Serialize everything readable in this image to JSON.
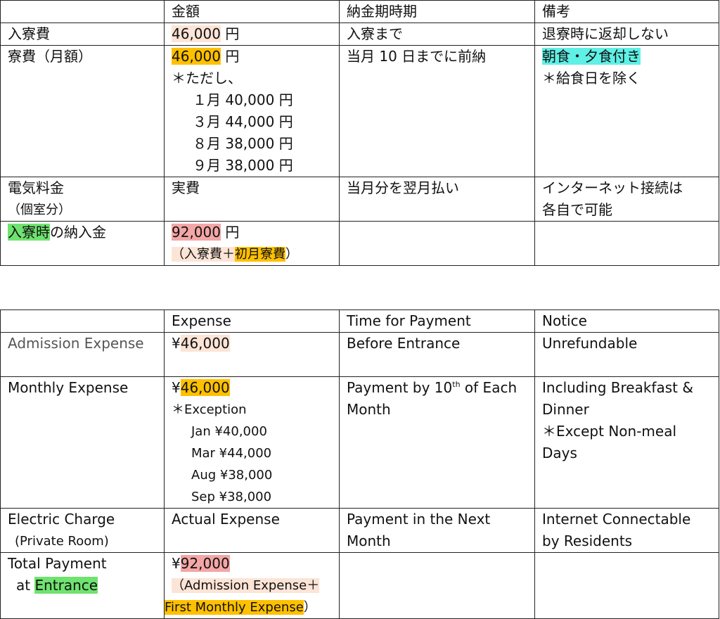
{
  "jp": {
    "headers": [
      "",
      "金額",
      "納金期時期",
      "備考"
    ],
    "row1": {
      "item": "入寮費",
      "amount_num": "46,000",
      "amount_unit": " 円",
      "timing": "入寮まで",
      "notice": "退寮時に返却しない"
    },
    "row2": {
      "item": "寮費（月額）",
      "amount_num": "46,000",
      "amount_unit": " 円",
      "exception_label": "＊ただし、",
      "exceptions": [
        "１月 40,000 円",
        "３月 44,000 円",
        "８月 38,000 円",
        "９月 38,000 円"
      ],
      "timing": "当月 10 日までに前納",
      "notice_highlight": "朝食・夕食付き",
      "notice_2": "＊給食日を除く"
    },
    "row3": {
      "item_1": "電気料金",
      "item_2": "（個室分）",
      "amount": "実費",
      "timing": "当月分を翌月払い",
      "notice_1": "インターネット接続は",
      "notice_2": "各自で可能"
    },
    "row4": {
      "item_highlight": "入寮時",
      "item_rest": "の納入金",
      "amount_num": "92,000",
      "amount_unit": " 円",
      "breakdown_open": "（入寮費＋",
      "breakdown_highlight": "初月寮費",
      "breakdown_close": "）"
    }
  },
  "en": {
    "headers": [
      "",
      "Expense",
      "Time for Payment",
      "Notice"
    ],
    "row1": {
      "item": "Admission Expense",
      "yen": "¥",
      "amount_num": "46,000",
      "timing": "Before Entrance",
      "notice": "Unrefundable"
    },
    "row2": {
      "item": "Monthly Expense",
      "yen": "¥",
      "amount_num": "46,000",
      "exception_label": "＊Exception",
      "exceptions": [
        "Jan ¥40,000",
        "Mar ¥44,000",
        "Aug ¥38,000",
        "Sep ¥38,000"
      ],
      "timing_a": "Payment by 10",
      "timing_sup": "th",
      "timing_b": " of Each",
      "timing_2": "Month",
      "notice_1": "Including Breakfast &",
      "notice_2": "Dinner",
      "notice_3": "＊Except Non-meal",
      "notice_4": "Days"
    },
    "row3": {
      "item_1": "Electric Charge",
      "item_2": "(Private Room)",
      "amount": "Actual Expense",
      "timing_1": "Payment in the Next",
      "timing_2": "Month",
      "notice_1": "Internet Connectable",
      "notice_2": "by Residents"
    },
    "row4": {
      "item_1": "Total Payment",
      "item_2_prefix": "at ",
      "item_2_highlight": "Entrance",
      "yen": "¥",
      "amount_num": "92,000",
      "breakdown_1": "（Admission Expense＋",
      "breakdown_2": "First Monthly Expense",
      "breakdown_close": "）"
    }
  },
  "colors": {
    "peach": "#fce4d6",
    "orange": "#ffc000",
    "pink": "#f4a6a6",
    "green": "#6fe36f",
    "cyan": "#5ff0e6"
  }
}
